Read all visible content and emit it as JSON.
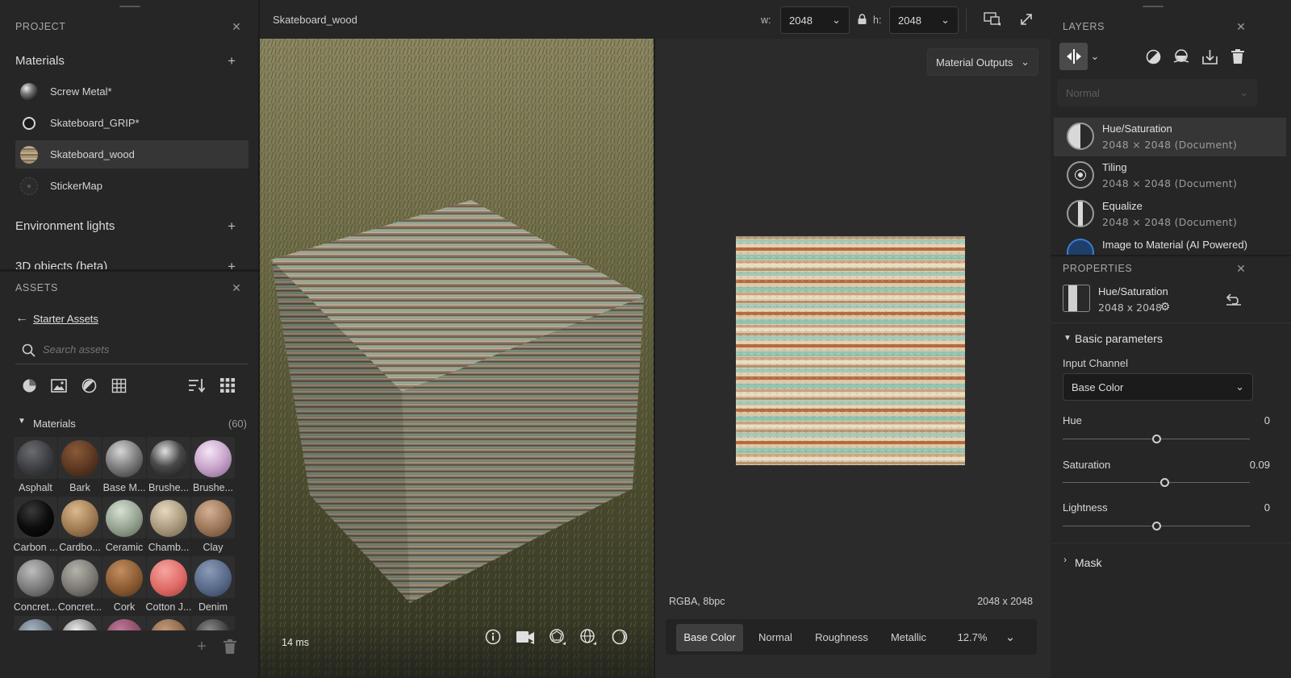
{
  "project": {
    "title": "PROJECT",
    "materials_header": "Materials",
    "materials": [
      "Screw Metal*",
      "Skateboard_GRIP*",
      "Skateboard_wood",
      "StickerMap"
    ],
    "environment_header": "Environment lights",
    "objects_header": "3D objects (beta)"
  },
  "assets": {
    "title": "ASSETS",
    "breadcrumb": "Starter Assets",
    "search_placeholder": "Search assets",
    "materials_label": "Materials",
    "materials_count": "(60)",
    "tiles": [
      "Asphalt",
      "Bark",
      "Base M...",
      "Brushe...",
      "Brushe...",
      "Carbon ...",
      "Cardbo...",
      "Ceramic",
      "Chamb...",
      "Clay",
      "Concret...",
      "Concret...",
      "Cork",
      "Cotton J...",
      "Denim"
    ]
  },
  "viewport": {
    "doc_title": "Skateboard_wood",
    "w_label": "w:",
    "w_value": "2048",
    "h_label": "h:",
    "h_value": "2048",
    "render_time": "14 ms",
    "outputs_label": "Material Outputs",
    "format": "RGBA, 8bpc",
    "size": "2048 x 2048",
    "channels": [
      "Base Color",
      "Normal",
      "Roughness",
      "Metallic"
    ],
    "active_channel": "Base Color",
    "zoom": "12.7%"
  },
  "layers": {
    "title": "LAYERS",
    "blend_mode": "Normal",
    "items": [
      {
        "name": "Hue/Saturation",
        "detail": "2048 × 2048 (Document)"
      },
      {
        "name": "Tiling",
        "detail": "2048 × 2048 (Document)"
      },
      {
        "name": "Equalize",
        "detail": "2048 × 2048 (Document)"
      },
      {
        "name": "Image to Material (AI Powered)",
        "detail": ""
      }
    ]
  },
  "properties": {
    "title": "PROPERTIES",
    "layer_name": "Hue/Saturation",
    "layer_size": "2048 x 2048",
    "basic_header": "Basic parameters",
    "input_channel_label": "Input Channel",
    "input_channel_value": "Base Color",
    "hue_label": "Hue",
    "hue_value": "0",
    "hue_pos": 0.5,
    "saturation_label": "Saturation",
    "saturation_value": "0.09",
    "saturation_pos": 0.545,
    "lightness_label": "Lightness",
    "lightness_value": "0",
    "lightness_pos": 0.5,
    "mask_header": "Mask"
  }
}
